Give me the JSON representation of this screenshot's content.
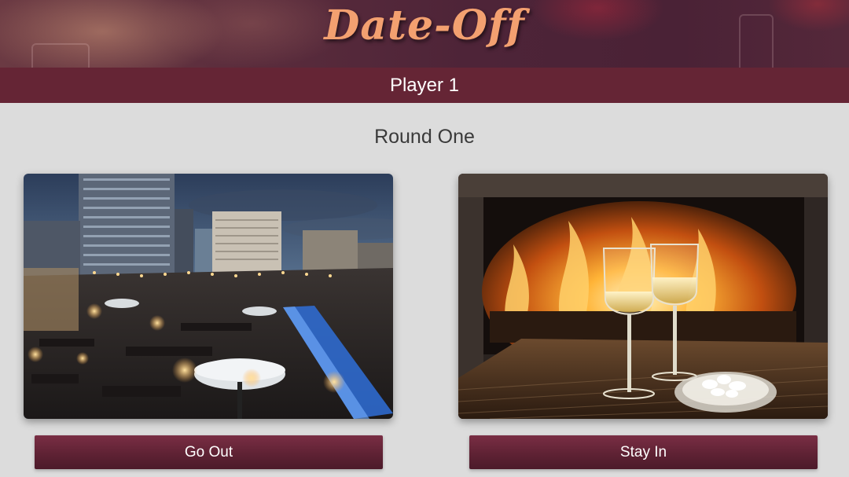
{
  "header": {
    "brand": "Date-Off",
    "player_label": "Player 1"
  },
  "round": {
    "title": "Round One"
  },
  "choices": [
    {
      "label": "Go Out",
      "image": "rooftop-restaurant-night-photo"
    },
    {
      "label": "Stay In",
      "image": "fireplace-wine-glasses-photo"
    }
  ],
  "colors": {
    "brand_text": "#f3a070",
    "bar": "#652535",
    "button": "#5f2234",
    "background": "#dcdcdc"
  }
}
